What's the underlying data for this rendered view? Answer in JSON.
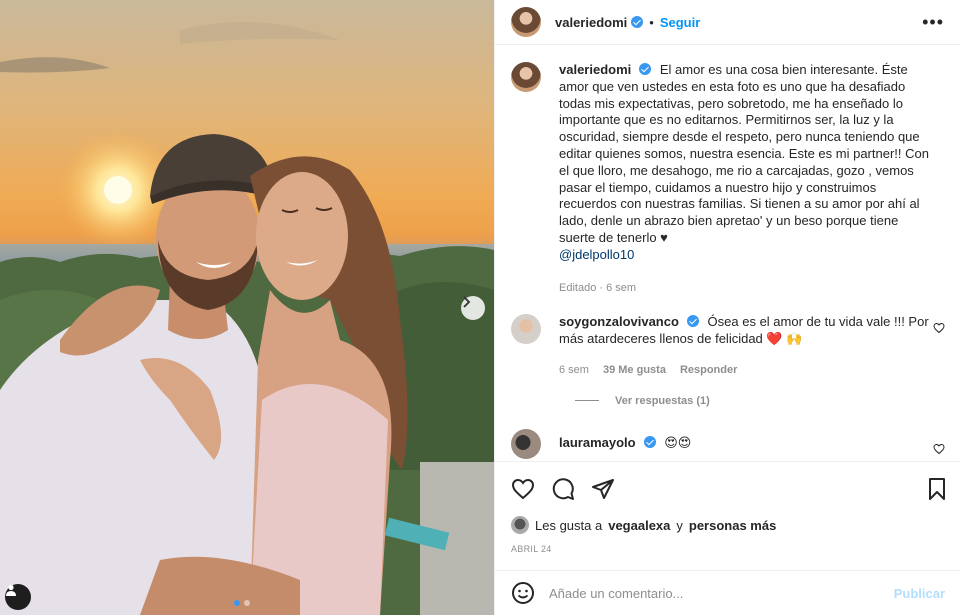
{
  "post": {
    "username": "valeriedomi",
    "follow_label": "Seguir",
    "more_label": "•••",
    "caption": "El amor es una cosa bien interesante. Éste amor que ven ustedes en esta foto es uno que ha desafiado todas mis expectativas, pero sobretodo, me ha enseñado lo importante que es no editarnos. Permitirnos ser, la luz y la oscuridad, siempre desde el respeto, pero nunca teniendo que editar quienes somos, nuestra esencia. Este es mi partner!! Con el que lloro, me desahogo, me rio a carcajadas, gozo , vemos pasar el tiempo, cuidamos a nuestro hijo y construimos recuerdos con nuestras familias. Si tienen a su amor por ahí al lado, denle un abrazo bien apretao' y un beso porque tiene suerte de tenerlo ♥",
    "caption_mention": "@jdelpollo10",
    "caption_meta": "Editado · 6 sem"
  },
  "comments": [
    {
      "username": "soygonzalovivanco",
      "text": "Ósea es el amor de tu vida vale !!! Por más atardeceres llenos de felicidad",
      "emoji": "❤️ 🙌",
      "time": "6 sem",
      "likes": "39 Me gusta",
      "reply": "Responder",
      "view_replies": "Ver respuestas (1)"
    },
    {
      "username": "lauramayolo",
      "text": "😍😍"
    }
  ],
  "likes": {
    "prefix": "Les gusta a",
    "user": "vegaalexa",
    "conjunction": "y",
    "others": "personas más"
  },
  "date": "ABRIL 24",
  "add_comment": {
    "placeholder": "Añade un comentario...",
    "publish": "Publicar"
  },
  "icons": [
    "heart-icon",
    "comment-icon",
    "share-icon",
    "bookmark-icon",
    "emoji-icon",
    "tag-user-icon",
    "chevron-right-icon"
  ],
  "colors": {
    "accent": "#0095f6",
    "verified": "#3897f0",
    "heart": "#ed4956"
  }
}
